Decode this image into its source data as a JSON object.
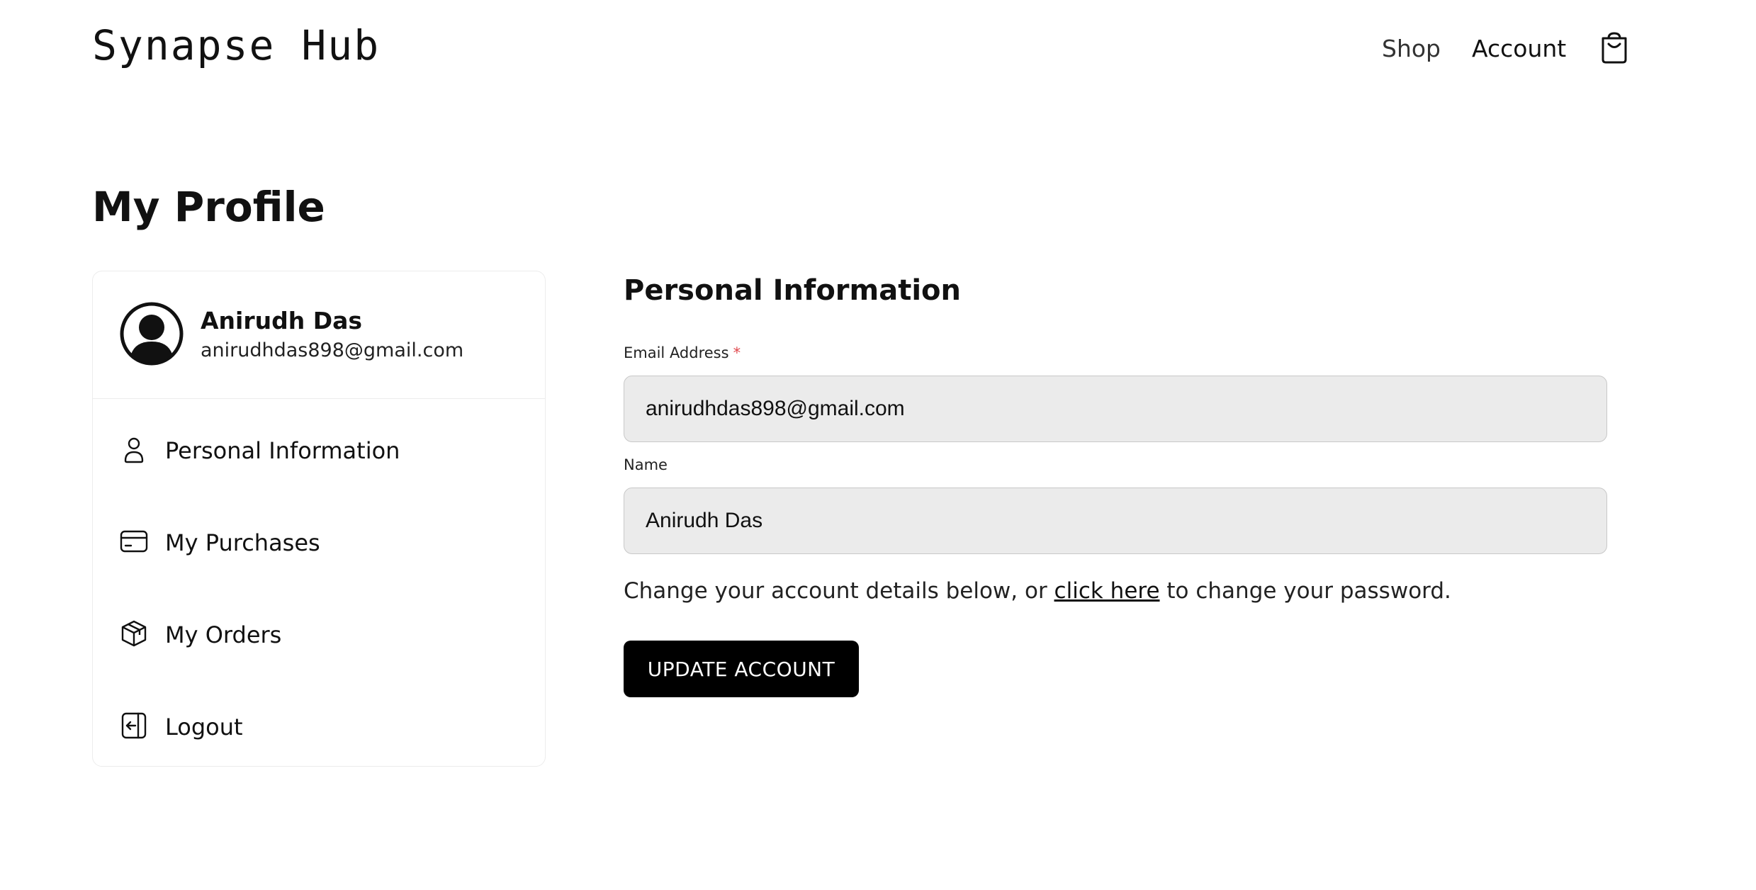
{
  "brand": "Synapse Hub",
  "nav": {
    "shop": "Shop",
    "account": "Account",
    "cart_icon": "shopping-bag-icon"
  },
  "page_title": "My Profile",
  "sidebar": {
    "profile": {
      "name": "Anirudh Das",
      "email": "anirudhdas898@gmail.com",
      "avatar_icon": "user-circle-icon"
    },
    "items": [
      {
        "label": "Personal Information",
        "icon": "user-icon"
      },
      {
        "label": "My Purchases",
        "icon": "credit-card-icon"
      },
      {
        "label": "My Orders",
        "icon": "package-icon"
      },
      {
        "label": "Logout",
        "icon": "logout-icon"
      }
    ]
  },
  "form": {
    "title": "Personal Information",
    "email_label": "Email Address",
    "required_mark": "*",
    "email_value": "anirudhdas898@gmail.com",
    "name_label": "Name",
    "name_value": "Anirudh Das",
    "help_before": "Change your account details below, or ",
    "help_link": "click here",
    "help_after": " to change your password.",
    "submit_label": "UPDATE ACCOUNT"
  },
  "colors": {
    "accent": "#000000",
    "field_bg": "#ebebeb",
    "required": "#e0474c"
  }
}
